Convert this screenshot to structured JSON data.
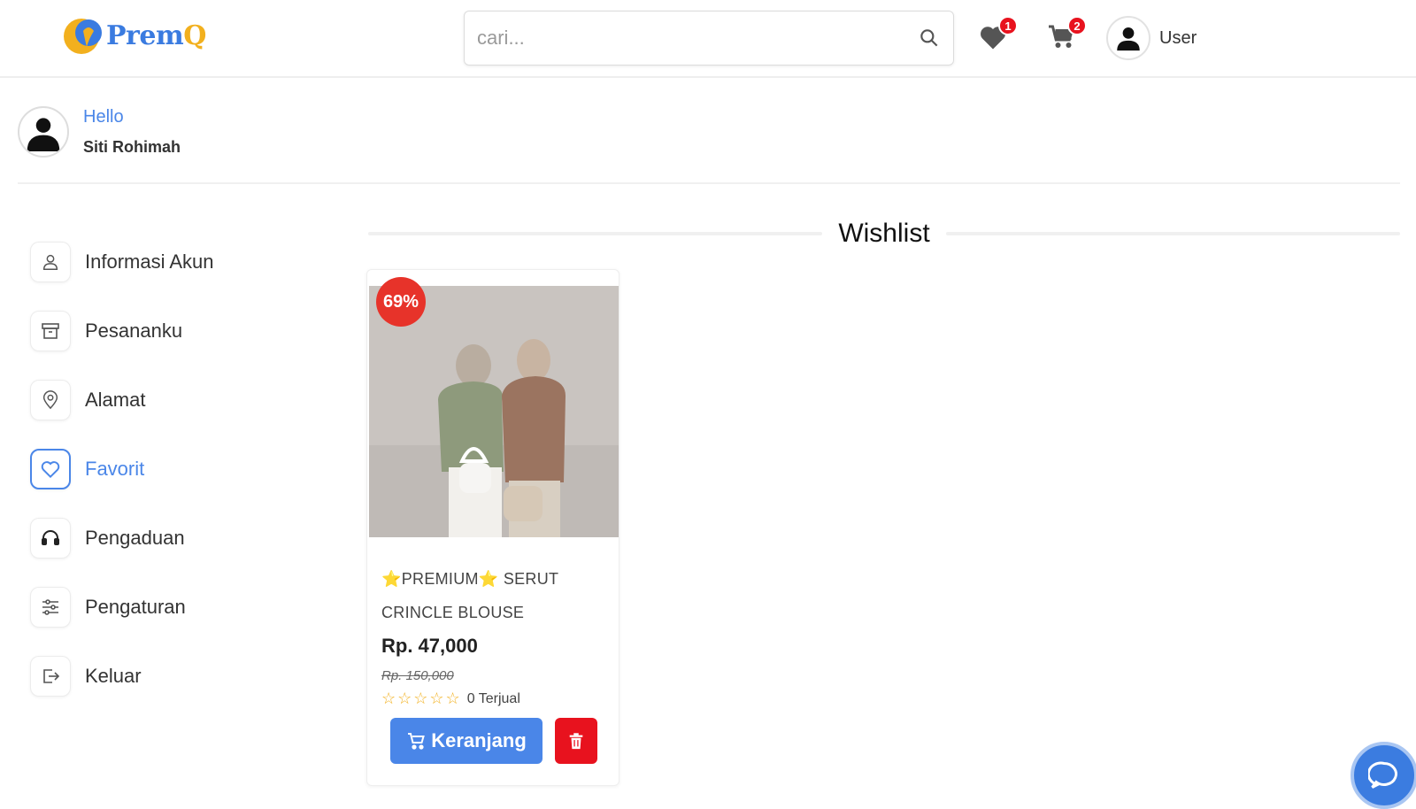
{
  "header": {
    "logo_text_main": "Prem",
    "logo_text_q": "Q",
    "search_placeholder": "cari...",
    "wishlist_count": "1",
    "cart_count": "2",
    "user_label": "User"
  },
  "profile": {
    "greeting": "Hello",
    "name": "Siti Rohimah"
  },
  "sidebar": {
    "items": [
      {
        "label": "Informasi Akun",
        "icon": "user-icon"
      },
      {
        "label": "Pesananku",
        "icon": "archive-icon"
      },
      {
        "label": "Alamat",
        "icon": "location-pin-icon"
      },
      {
        "label": "Favorit",
        "icon": "heart-icon",
        "active": true
      },
      {
        "label": "Pengaduan",
        "icon": "headset-icon"
      },
      {
        "label": "Pengaturan",
        "icon": "sliders-icon"
      },
      {
        "label": "Keluar",
        "icon": "logout-icon"
      }
    ]
  },
  "wishlist": {
    "title": "Wishlist",
    "products": [
      {
        "discount": "69%",
        "name_line1": "⭐PREMIUM⭐ SERUT",
        "name_line2": "CRINCLE BLOUSE",
        "price": "Rp. 47,000",
        "old_price": "Rp. 150,000",
        "stars": "☆☆☆☆☆",
        "sold": "0 Terjual",
        "cart_button": "Keranjang"
      }
    ]
  },
  "colors": {
    "primary": "#4a86e8",
    "danger": "#e8121e",
    "accent_yellow": "#f2b01e"
  }
}
